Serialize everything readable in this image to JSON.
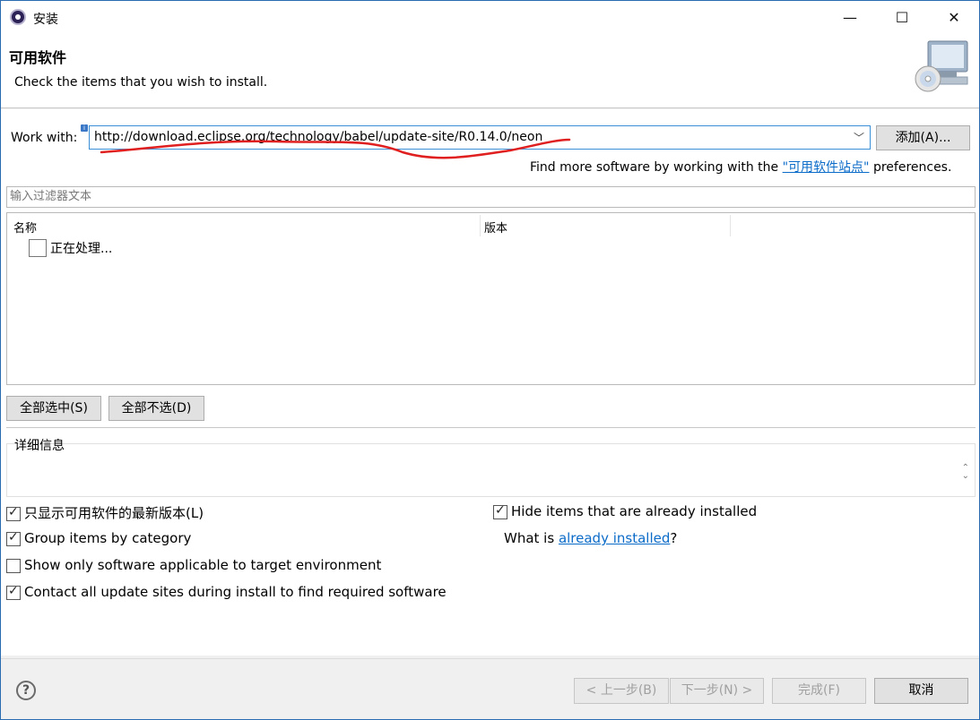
{
  "window": {
    "title": "安装"
  },
  "header": {
    "title": "可用软件",
    "description": "Check the items that you wish to install."
  },
  "work_with": {
    "label": "Work with:",
    "url": "http://download.eclipse.org/technology/babel/update-site/R0.14.0/neon",
    "add_button": "添加(A)...",
    "more_prefix": "Find more software by working with the ",
    "more_link": "\"可用软件站点\"",
    "more_suffix": " preferences."
  },
  "filter": {
    "placeholder": "输入过滤器文本"
  },
  "tree": {
    "columns": [
      "名称",
      "版本"
    ],
    "rows": [
      {
        "label": "正在处理...",
        "checked": false
      }
    ]
  },
  "selection_buttons": {
    "select_all": "全部选中(S)",
    "deselect_all": "全部不选(D)"
  },
  "details": {
    "label": "详细信息"
  },
  "options": {
    "latest_only": {
      "label": "只显示可用软件的最新版本(L)",
      "checked": true
    },
    "group_by_category": {
      "label": "Group items by category",
      "checked": true
    },
    "target_env_only": {
      "label": "Show only software applicable to target environment",
      "checked": false
    },
    "contact_sites": {
      "label": "Contact all update sites during install to find required software",
      "checked": true
    },
    "hide_installed": {
      "label": "Hide items that are already installed",
      "checked": true
    },
    "what_is_prefix": "What is ",
    "what_is_link": "already installed",
    "what_is_suffix": "?"
  },
  "footer": {
    "help_icon": "help-icon",
    "back": "< 上一步(B)",
    "next": "下一步(N) >",
    "finish": "完成(F)",
    "cancel": "取消"
  },
  "colors": {
    "link": "#0b6bc8",
    "annotation": "#e02020",
    "focus_border": "#3b8fd6"
  }
}
